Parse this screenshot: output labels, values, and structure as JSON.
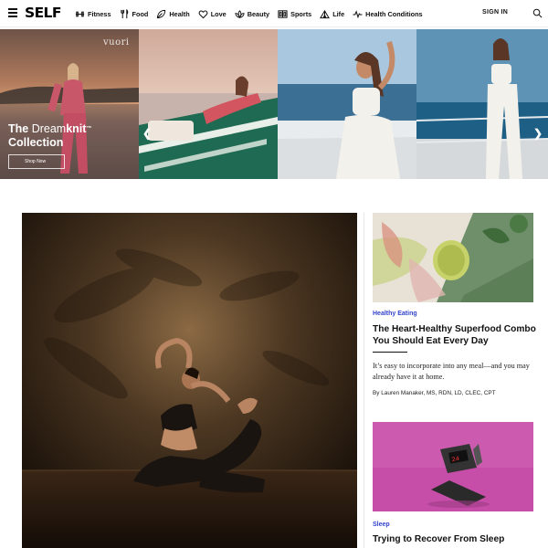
{
  "nav": {
    "logo": "SELF",
    "items": [
      {
        "label": "Fitness",
        "icon": "dumbbell-icon"
      },
      {
        "label": "Food",
        "icon": "utensils-icon"
      },
      {
        "label": "Health",
        "icon": "leaf-icon"
      },
      {
        "label": "Love",
        "icon": "heart-icon"
      },
      {
        "label": "Beauty",
        "icon": "lotus-icon"
      },
      {
        "label": "Sports",
        "icon": "scoreboard-icon"
      },
      {
        "label": "Life",
        "icon": "tent-icon"
      },
      {
        "label": "Health Conditions",
        "icon": "pulse-icon"
      }
    ],
    "signin": "SIGN IN"
  },
  "promo": {
    "brand": "vuori",
    "title_strong": "The ",
    "title_light": "Dream",
    "title_strong2": "knit",
    "title_tm": "™",
    "title_line2": "Collection",
    "cta": "Shop Now"
  },
  "cards": [
    {
      "category": "Healthy Eating",
      "headline": "The Heart-Healthy Superfood Combo You Should Eat Every Day",
      "dek": "It’s easy to incorporate into any meal—and you may already have it at home.",
      "byline": "By Lauren Manaker, MS, RDN, LD, CLEC, CPT"
    },
    {
      "category": "Sleep",
      "headline": "Trying to Recover From Sleep"
    }
  ],
  "colors": {
    "accent": "#3344cc",
    "promo_bg": "#a65a5a",
    "feature_bg": "#2a1a0e",
    "card2_bg": "#c94fa8"
  }
}
